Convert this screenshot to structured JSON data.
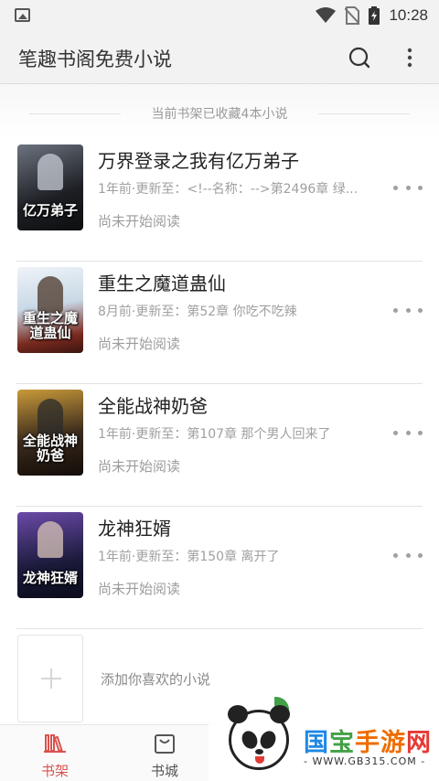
{
  "status_bar": {
    "time": "10:28",
    "icons": [
      "image-notification-icon",
      "wifi-icon",
      "no-sim-icon",
      "battery-charging-icon"
    ]
  },
  "app_bar": {
    "title": "笔趣书阁免费小说",
    "icons": [
      "search-icon",
      "more-vert-icon"
    ]
  },
  "shelf": {
    "count_text": "当前书架已收藏4本小说"
  },
  "books": [
    {
      "title": "万界登录之我有亿万弟子",
      "meta": "1年前·更新至：<!--名称：-->第2496章 绿...",
      "progress": "尚未开始阅读",
      "cover_text": "亿万弟子",
      "cover_colors": [
        "#1d1f24",
        "#6d7480"
      ]
    },
    {
      "title": "重生之魔道蛊仙",
      "meta": "8月前·更新至：第52章 你吃不吃辣",
      "progress": "尚未开始阅读",
      "cover_text": "重生之魔道蛊仙",
      "cover_colors": [
        "#dfe8f2",
        "#7a2a1f"
      ]
    },
    {
      "title": "全能战神奶爸",
      "meta": "1年前·更新至：第107章 那个男人回来了",
      "progress": "尚未开始阅读",
      "cover_text": "全能战神奶爸",
      "cover_colors": [
        "#3a2a1c",
        "#c99a3a"
      ]
    },
    {
      "title": "龙神狂婿",
      "meta": "1年前·更新至：第150章 离开了",
      "progress": "尚未开始阅读",
      "cover_text": "龙神狂婿",
      "cover_colors": [
        "#1a1a3a",
        "#6b4aa8"
      ]
    }
  ],
  "add_book": {
    "label": "添加你喜欢的小说"
  },
  "bottom_nav": {
    "items": [
      {
        "label": "书架",
        "active": true
      },
      {
        "label": "书城",
        "active": false
      }
    ]
  },
  "watermark": {
    "name_chars": [
      "国",
      "宝",
      "手游",
      "网"
    ],
    "url": "- WWW.GB315.COM -"
  },
  "colors": {
    "accent": "#d9534f",
    "bar_bg": "#f2f2f2",
    "text_gray": "#a0a0a0"
  }
}
